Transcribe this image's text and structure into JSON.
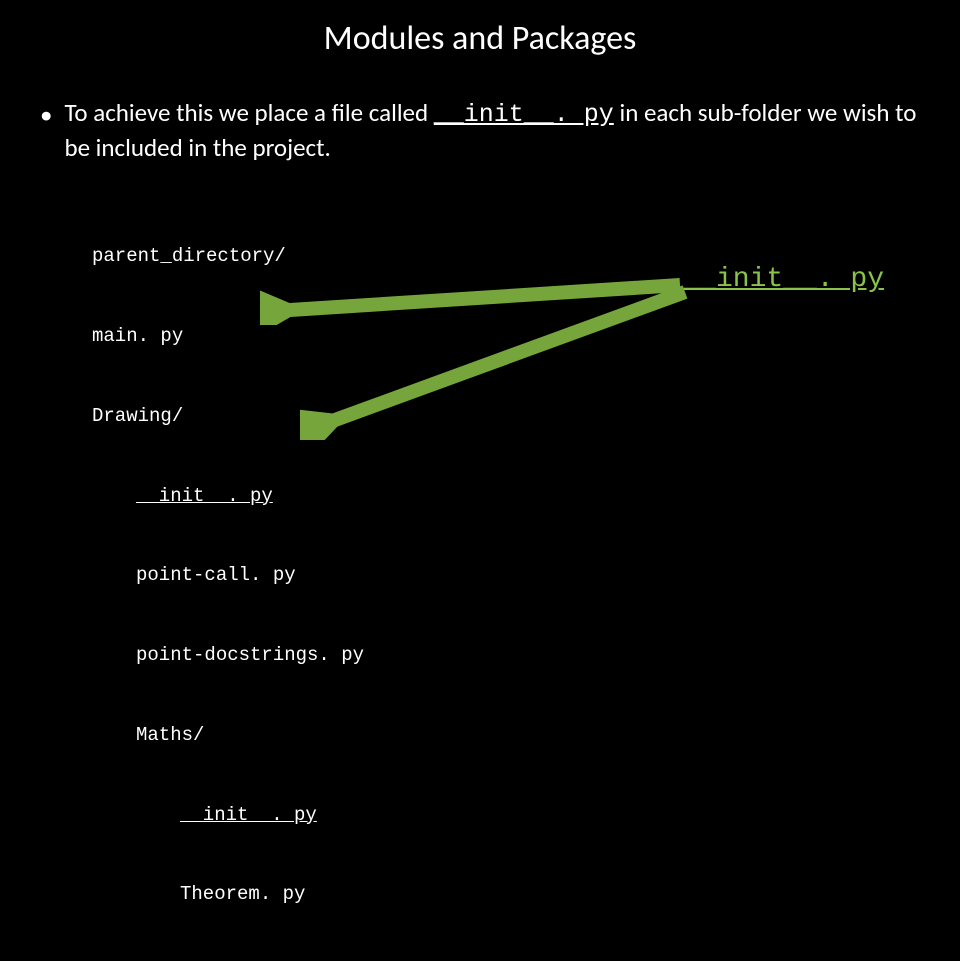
{
  "title": "Modules and Packages",
  "bullet": {
    "lead": "To achieve this we place a file called ",
    "code": "__init__. py",
    "tail": " in each sub-folder we wish to be included in the project."
  },
  "tree": {
    "l1": "parent_directory/",
    "l2": "main. py",
    "l3": "Drawing/",
    "l4": "__init__. py",
    "l5": "point-call. py",
    "l6": "point-docstrings. py",
    "l7": "Maths/",
    "l8": "__init__. py",
    "l9": "Theorem. py"
  },
  "callout": "__init__. py",
  "colors": {
    "accent": "#8bc34a"
  }
}
